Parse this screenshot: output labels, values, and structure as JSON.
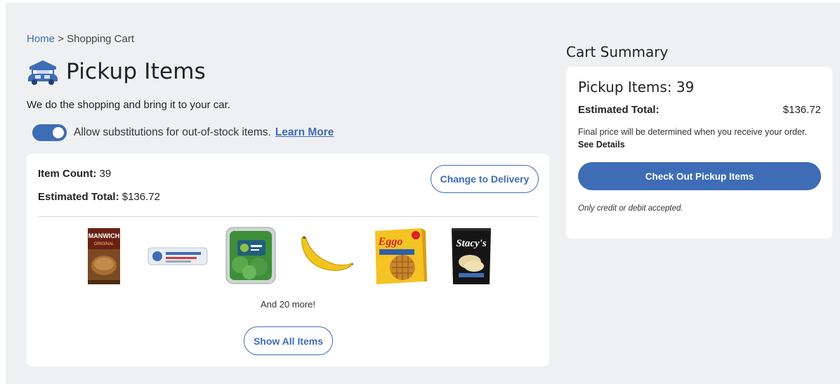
{
  "breadcrumb": {
    "home": "Home",
    "separator": ">",
    "current": "Shopping Cart"
  },
  "header": {
    "title": "Pickup Items",
    "subtitle": "We do the shopping and bring it to your car.",
    "icon": "car-pickup-icon"
  },
  "substitutions": {
    "enabled": true,
    "label": "Allow substitutions for out-of-stock items.",
    "link": "Learn More"
  },
  "cart": {
    "item_count_label": "Item Count:",
    "item_count_value": "39",
    "total_label": "Estimated Total:",
    "total_value": "$136.72",
    "change_button": "Change to Delivery",
    "products": [
      {
        "name": "manwich-can",
        "label": "MANWICH",
        "sublabel": "ORIGINAL"
      },
      {
        "name": "egg-carton",
        "label": ""
      },
      {
        "name": "spinach-container",
        "label": ""
      },
      {
        "name": "banana",
        "label": ""
      },
      {
        "name": "eggo-waffles-box",
        "label": "Eggo"
      },
      {
        "name": "stacys-chips-bag",
        "label": "Stacy's"
      }
    ],
    "more_text": "And 20 more!",
    "show_all_button": "Show All Items"
  },
  "summary": {
    "heading": "Cart Summary",
    "items_line": "Pickup Items: 39",
    "total_label": "Estimated Total:",
    "total_value": "$136.72",
    "note": "Final price will be determined when you receive your order.",
    "note_link": "See Details",
    "checkout_button": "Check Out Pickup Items",
    "payment_note": "Only credit or debit accepted."
  },
  "colors": {
    "accent": "#3e6cb6",
    "page_background": "#eff0f2",
    "card_background": "#ffffff"
  }
}
